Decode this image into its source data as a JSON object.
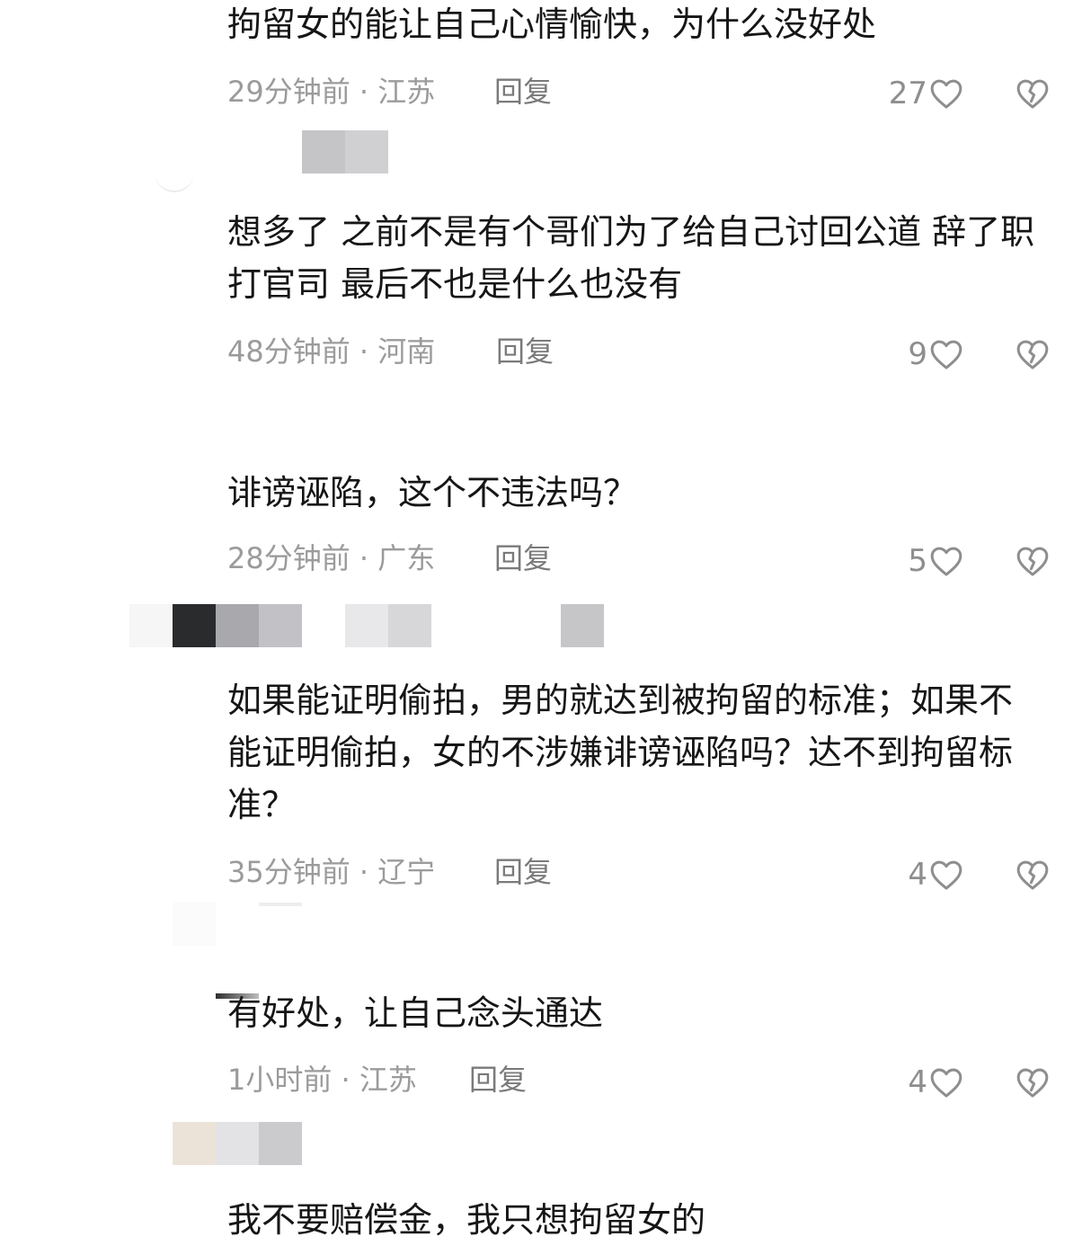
{
  "icons": {
    "like": "heart-outline-icon",
    "dislike": "broken-heart-icon"
  },
  "colors": {
    "text": "#161616",
    "meta": "#9b9b9b",
    "reply": "#7a7a7a",
    "icon": "#8e8e8e"
  },
  "comments": [
    {
      "text": "拘留女的能让自己心情愉快，为什么没好处",
      "time": "29分钟前 · 江苏",
      "reply": "回复",
      "likes": "27"
    },
    {
      "text": "想多了  之前不是有个哥们为了给自己讨回公道 辞了职打官司  最后不也是什么也没有",
      "time": "48分钟前 · 河南",
      "reply": "回复",
      "likes": "9"
    },
    {
      "text": "诽谤诬陷，这个不违法吗？",
      "time": "28分钟前 · 广东",
      "reply": "回复",
      "likes": "5"
    },
    {
      "text": "如果能证明偷拍，男的就达到被拘留的标准；如果不能证明偷拍，女的不涉嫌诽谤诬陷吗？达不到拘留标准？",
      "time": "35分钟前 · 辽宁",
      "reply": "回复",
      "likes": "4"
    },
    {
      "text": "有好处，让自己念头通达",
      "time": "1小时前 · 江苏",
      "reply": "回复",
      "likes": "4"
    },
    {
      "text": "我不要赔偿金，我只想拘留女的"
    }
  ]
}
